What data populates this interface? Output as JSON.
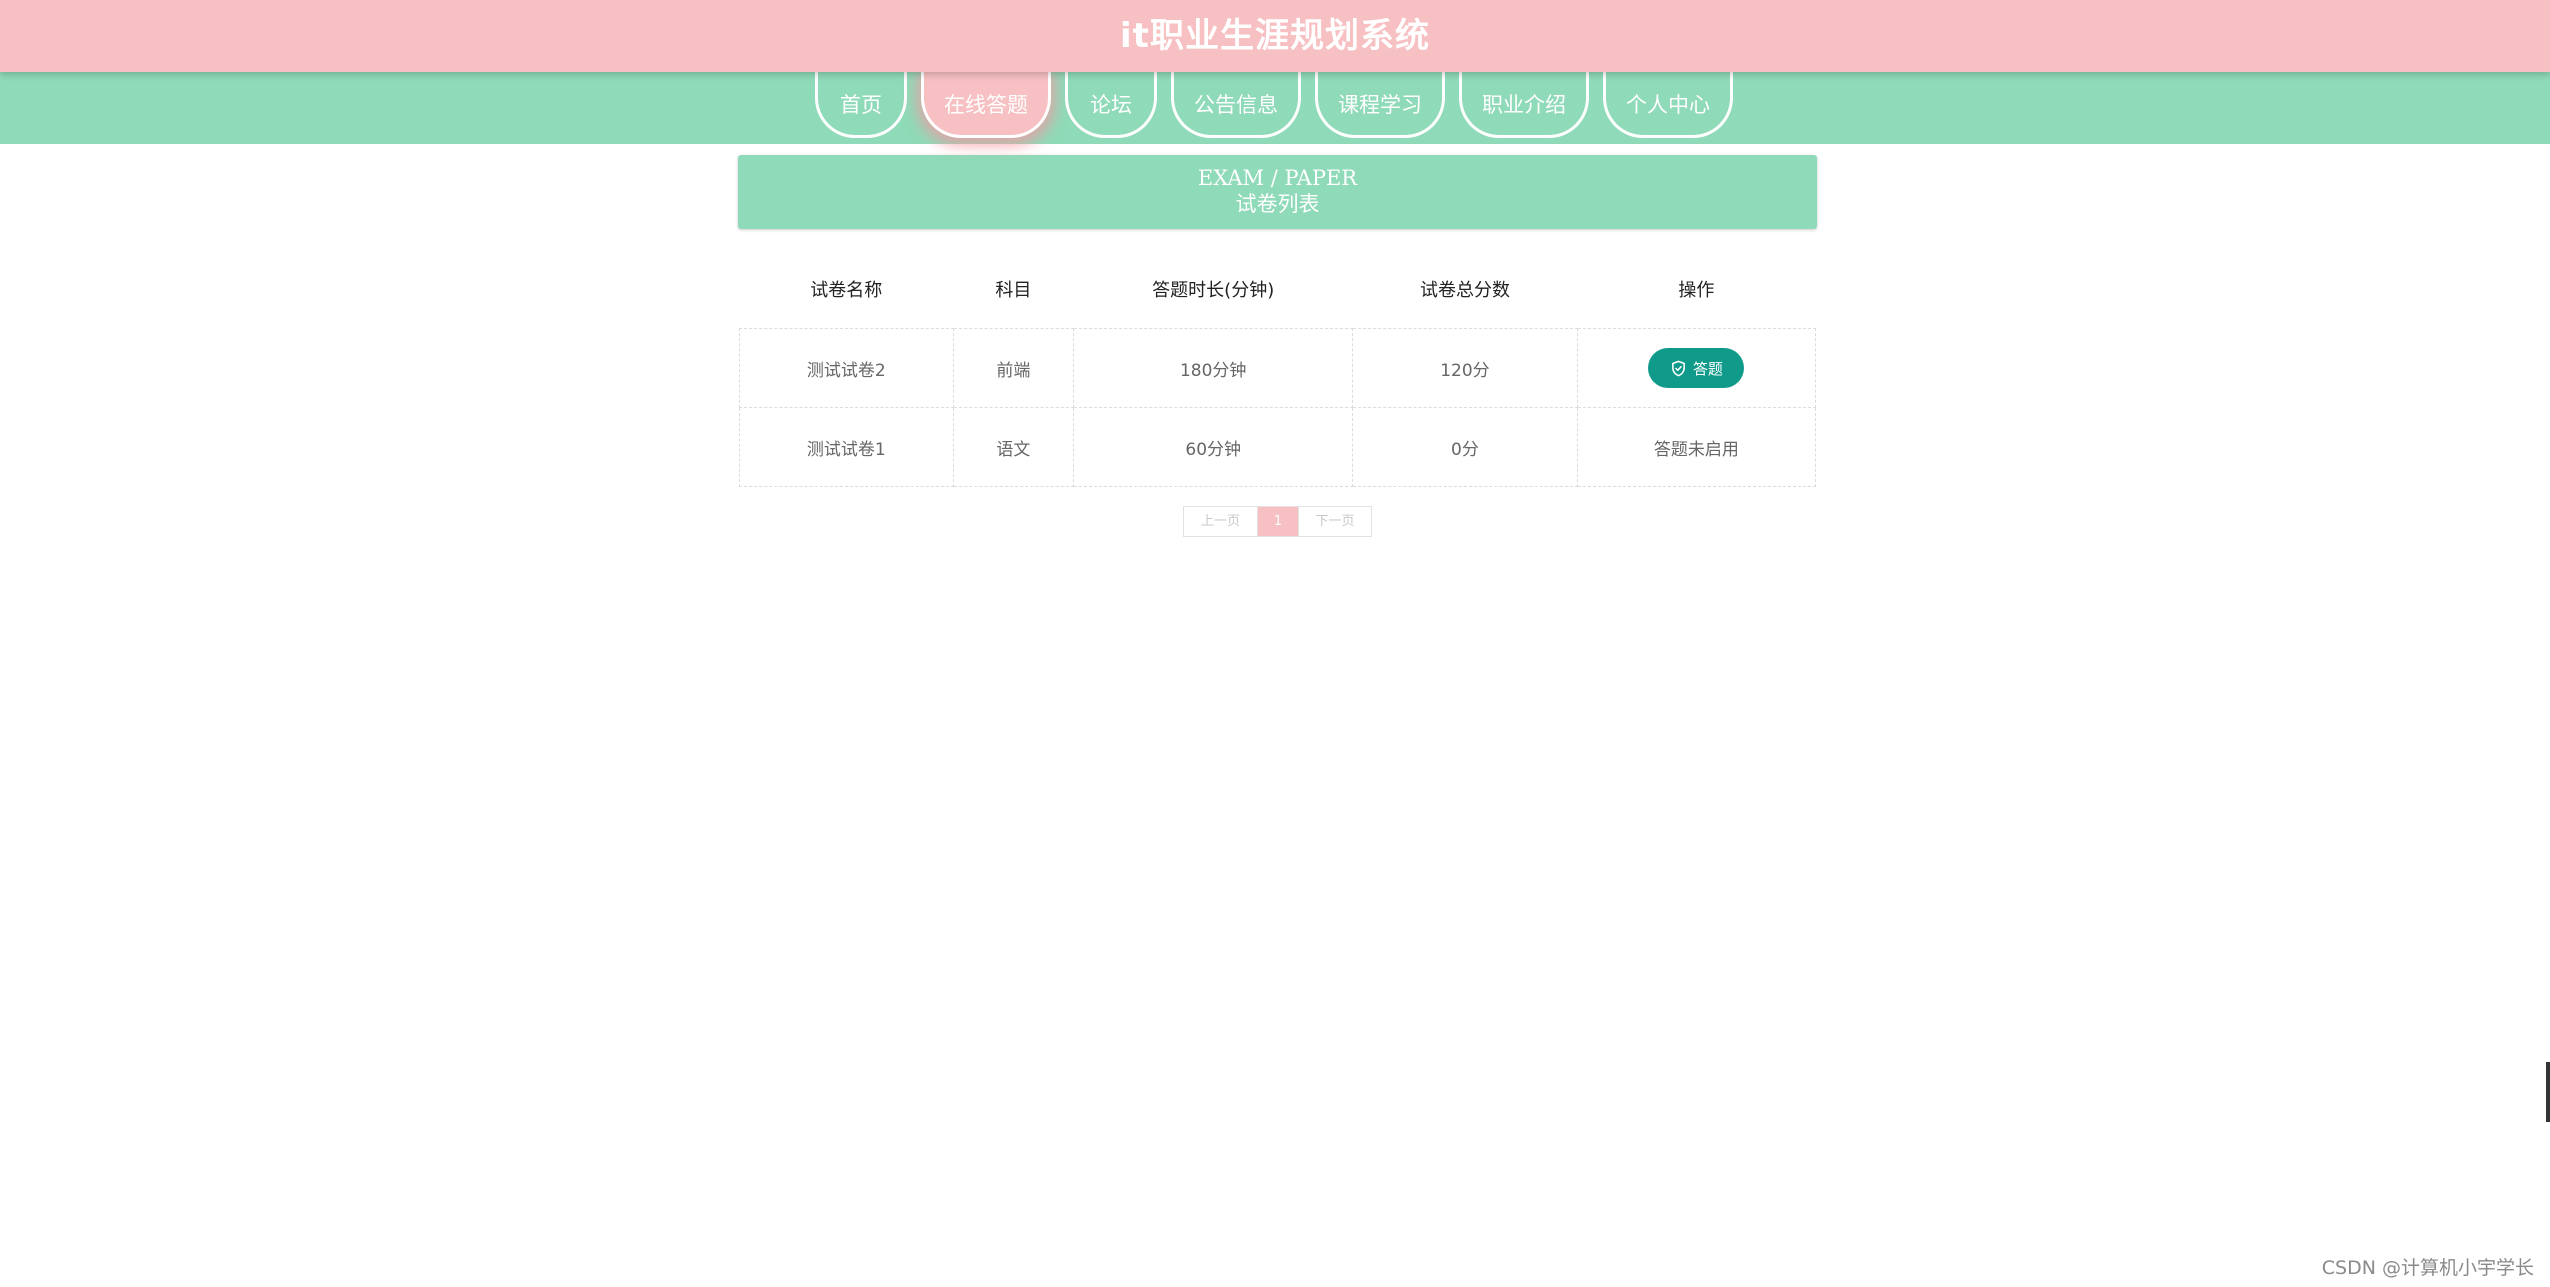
{
  "header": {
    "title": "it职业生涯规划系统"
  },
  "nav": {
    "items": [
      {
        "label": "首页"
      },
      {
        "label": "在线答题",
        "active": true
      },
      {
        "label": "论坛"
      },
      {
        "label": "公告信息"
      },
      {
        "label": "课程学习"
      },
      {
        "label": "职业介绍"
      },
      {
        "label": "个人中心"
      }
    ]
  },
  "banner": {
    "en": "EXAM / PAPER",
    "cn": "试卷列表"
  },
  "table": {
    "headers": [
      "试卷名称",
      "科目",
      "答题时长(分钟)",
      "试卷总分数",
      "操作"
    ],
    "rows": [
      {
        "name": "测试试卷2",
        "subject": "前端",
        "duration": "180分钟",
        "score": "120分",
        "action": "答题",
        "action_type": "button"
      },
      {
        "name": "测试试卷1",
        "subject": "语文",
        "duration": "60分钟",
        "score": "0分",
        "action": "答题未启用",
        "action_type": "text"
      }
    ]
  },
  "pagination": {
    "prev": "上一页",
    "current": "1",
    "next": "下一页"
  },
  "watermark": "CSDN @计算机小宇学长",
  "colors": {
    "header_bg": "#f7c0c2",
    "nav_bg": "#8fdab8",
    "button_bg": "#0f9a8a"
  },
  "icons": {
    "answer_button": "shield-check-icon"
  }
}
